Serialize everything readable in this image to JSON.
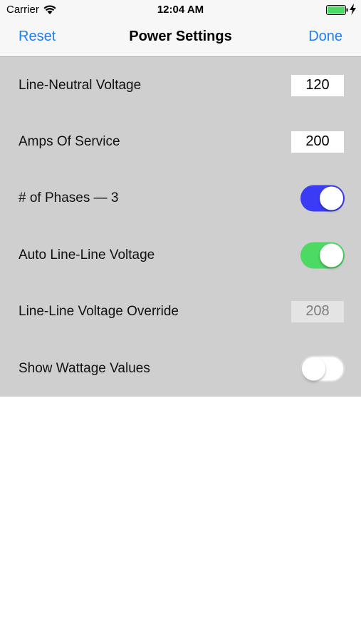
{
  "status_bar": {
    "carrier": "Carrier",
    "time": "12:04 AM",
    "icons": [
      "wifi-icon",
      "battery-icon",
      "charging-bolt-icon"
    ],
    "battery_color": "#4cd964"
  },
  "nav": {
    "left_label": "Reset",
    "title": "Power Settings",
    "right_label": "Done",
    "accent_color": "#1a7ef7"
  },
  "settings": {
    "line_neutral_voltage": {
      "label": "Line-Neutral Voltage",
      "value": "120"
    },
    "amps_of_service": {
      "label": "Amps Of Service",
      "value": "200"
    },
    "phases": {
      "label": "# of Phases — 3",
      "state": "on",
      "color": "#3b3bf5"
    },
    "auto_line_line": {
      "label": "Auto Line-Line Voltage",
      "state": "on",
      "color": "#4cd964"
    },
    "line_line_override": {
      "label": "Line-Line Voltage Override",
      "value": "208",
      "enabled": false
    },
    "show_wattage": {
      "label": "Show Wattage Values",
      "state": "off"
    }
  }
}
